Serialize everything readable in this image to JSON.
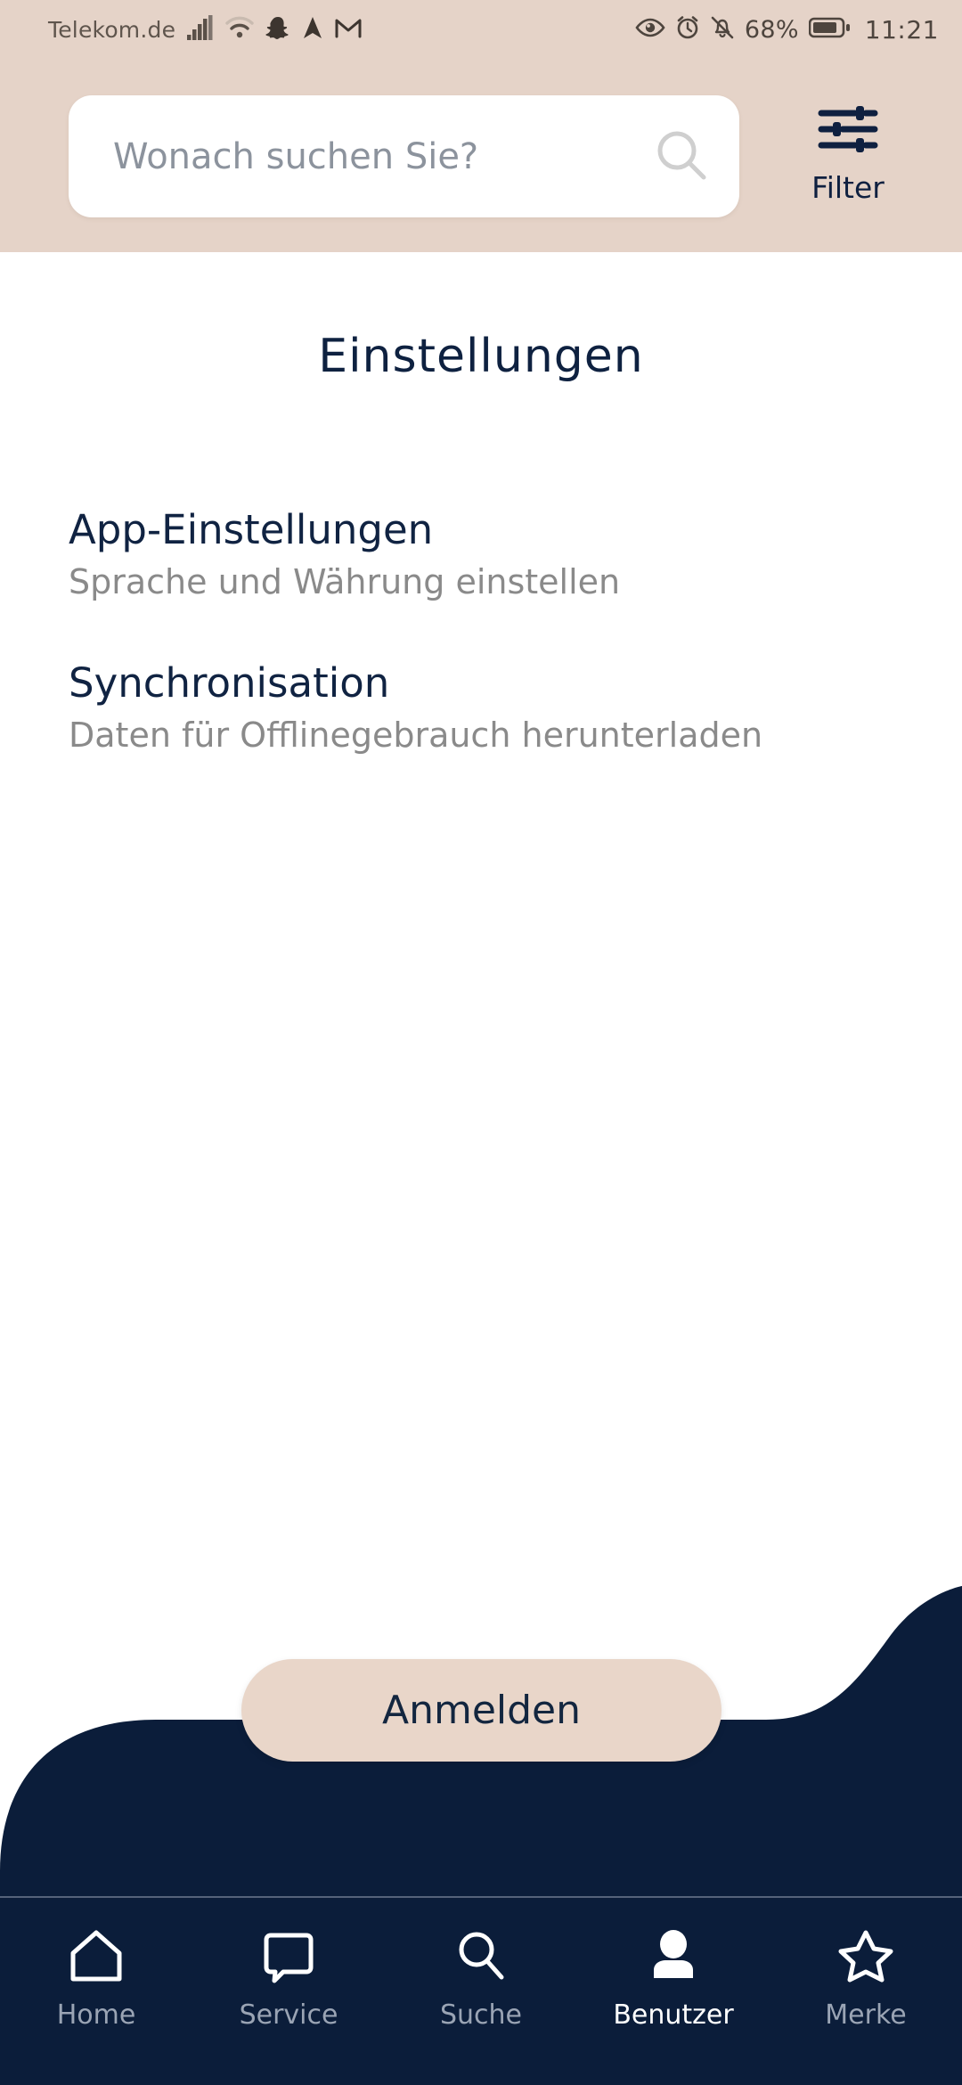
{
  "status_bar": {
    "carrier": "Telekom.de",
    "battery_percent": "68%",
    "time": "11:21",
    "left_icons": [
      "signal-bars-icon",
      "wifi-icon",
      "snapchat-icon",
      "navigation-arrow-icon",
      "gmail-icon"
    ],
    "right_icons": [
      "eye-icon",
      "alarm-clock-icon",
      "bell-muted-icon",
      "battery-icon"
    ]
  },
  "header": {
    "background_color": "#e5d3c8",
    "search": {
      "placeholder": "Wonach suchen Sie?",
      "value": "",
      "icon": "search-icon"
    },
    "filter": {
      "label": "Filter",
      "icon": "sliders-icon"
    }
  },
  "main": {
    "title": "Einstellungen",
    "items": [
      {
        "title": "App-Einstellungen",
        "subtitle": "Sprache und Währung einstellen"
      },
      {
        "title": "Synchronisation",
        "subtitle": "Daten für Offlinegebrauch herunterladen"
      }
    ],
    "primary_button": "Anmelden"
  },
  "bottom_nav": {
    "background_color": "#0b1d3a",
    "items": [
      {
        "label": "Home",
        "icon": "home-icon",
        "active": false
      },
      {
        "label": "Service",
        "icon": "chat-bubble-icon",
        "active": false
      },
      {
        "label": "Suche",
        "icon": "search-icon",
        "active": false
      },
      {
        "label": "Benutzer",
        "icon": "person-icon",
        "active": true
      },
      {
        "label": "Merke",
        "icon": "star-icon",
        "active": false
      }
    ]
  },
  "colors": {
    "beige": "#e5d3c8",
    "navy": "#0b1d3a",
    "title_navy": "#0e2140",
    "subtitle_gray": "#8a8a8a",
    "button_beige": "#e9d6c9"
  }
}
